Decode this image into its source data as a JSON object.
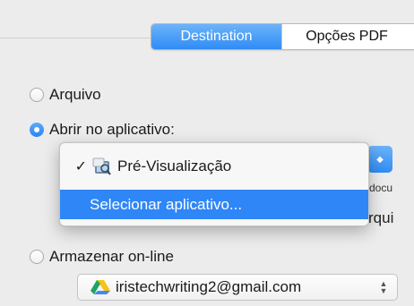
{
  "tabs": [
    {
      "label": "Destination",
      "active": true
    },
    {
      "label": "Opções PDF",
      "active": false
    }
  ],
  "options": {
    "arquivo": {
      "label": "Arquivo",
      "selected": false
    },
    "abrir": {
      "label": "Abrir no aplicativo:",
      "selected": true
    },
    "armazenar": {
      "label": "Armazenar on-line",
      "selected": false
    }
  },
  "popup_menu": {
    "items": [
      {
        "label": "Pré-Visualização",
        "checked": true,
        "icon": "preview-app-icon"
      },
      {
        "label": "Selecionar aplicativo...",
        "highlighted": true
      }
    ]
  },
  "clipped": {
    "docu": "docu",
    "rqui": "rqui"
  },
  "account": {
    "email": "iristechwriting2@gmail.com",
    "icon": "google-drive-icon"
  },
  "colors": {
    "accent": "#2f86f6",
    "background": "#ececec"
  }
}
